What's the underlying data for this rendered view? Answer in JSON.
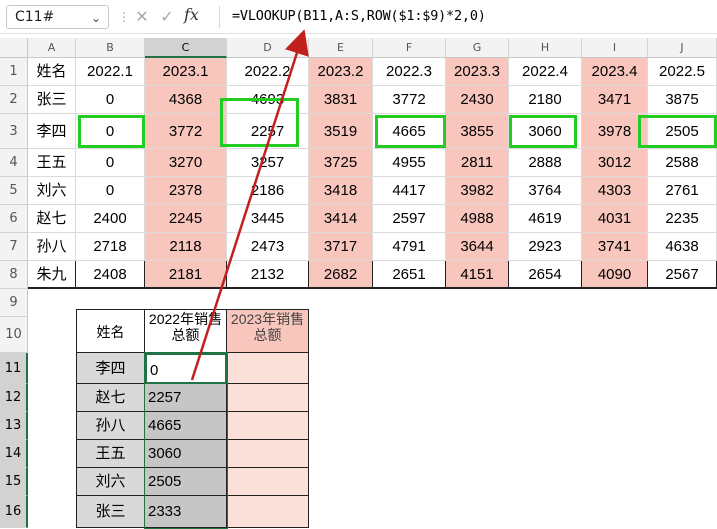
{
  "formula_bar": {
    "name_box": "C11#",
    "fx_label": "fx",
    "formula": "=VLOOKUP(B11,A:S,ROW($1:$9)*2,0)",
    "cancel_icon": "cross-icon",
    "confirm_icon": "check-icon"
  },
  "columns": [
    "A",
    "B",
    "C",
    "D",
    "E",
    "F",
    "G",
    "H",
    "I",
    "J"
  ],
  "rows": [
    "1",
    "2",
    "3",
    "4",
    "5",
    "6",
    "7",
    "8",
    "9",
    "10",
    "11",
    "12",
    "13",
    "14",
    "15",
    "16"
  ],
  "table1": {
    "header": [
      "姓名",
      "2022.1",
      "2023.1",
      "2022.2",
      "2023.2",
      "2022.3",
      "2023.3",
      "2022.4",
      "2023.4",
      "2022.5"
    ],
    "rows": [
      [
        "张三",
        "0",
        "4368",
        "4693",
        "3831",
        "3772",
        "2430",
        "2180",
        "3471",
        "3875"
      ],
      [
        "李四",
        "0",
        "3772",
        "2257",
        "3519",
        "4665",
        "3855",
        "3060",
        "3978",
        "2505"
      ],
      [
        "王五",
        "0",
        "3270",
        "3257",
        "3725",
        "4955",
        "2811",
        "2888",
        "3012",
        "2588"
      ],
      [
        "刘六",
        "0",
        "2378",
        "2186",
        "3418",
        "4417",
        "3982",
        "3764",
        "4303",
        "2761"
      ],
      [
        "赵七",
        "2400",
        "2245",
        "3445",
        "3414",
        "2597",
        "4988",
        "4619",
        "4031",
        "2235"
      ],
      [
        "孙八",
        "2718",
        "2118",
        "2473",
        "3717",
        "4791",
        "3644",
        "2923",
        "3741",
        "4638"
      ],
      [
        "朱九",
        "2408",
        "2181",
        "2132",
        "2682",
        "2651",
        "4151",
        "2654",
        "4090",
        "2567"
      ]
    ]
  },
  "table2": {
    "header_name": "姓名",
    "header_2022": "2022年销售总额",
    "header_2023": "2023年销售总额",
    "rows": [
      [
        "李四",
        "0"
      ],
      [
        "赵七",
        "2257"
      ],
      [
        "孙八",
        "4665"
      ],
      [
        "王五",
        "3060"
      ],
      [
        "刘六",
        "2505"
      ],
      [
        "张三",
        "2333"
      ]
    ]
  },
  "colors": {
    "pink_fill": "#f8c6bc",
    "highlight_green": "#22cc22",
    "arrow_red": "#c0201e",
    "selection_green": "#217346"
  }
}
